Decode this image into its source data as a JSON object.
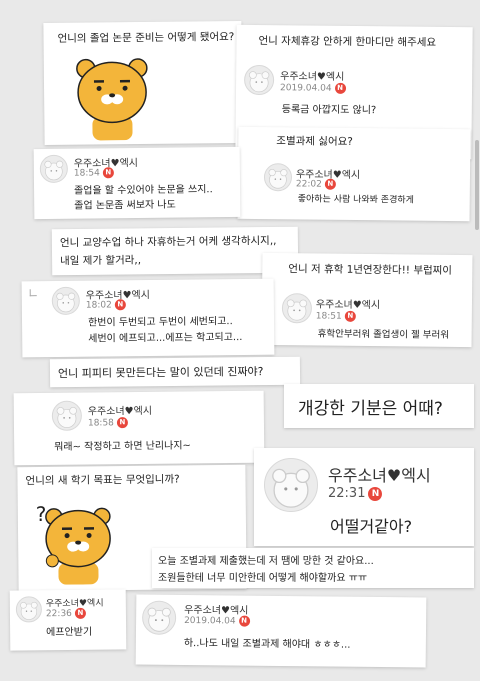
{
  "items": [
    {
      "question": "언니의 졸업 논문 준비는 어떻게 됐어요?"
    },
    {
      "question": "언니 자체휴강 안하게 한마디만 해주세요",
      "user": "우주소녀♥엑시",
      "time": "2019.04.04",
      "badge": "N",
      "lines": [
        "등록금 아깝지도 않니?"
      ]
    },
    {
      "question": "조별과제 싫어요?",
      "user": "우주소녀♥엑시",
      "time": "22:02",
      "badge": "N",
      "lines": [
        "좋아하는 사람 나와봐 존경하게"
      ]
    },
    {
      "user": "우주소녀♥엑시",
      "time": "18:54",
      "badge": "N",
      "lines": [
        "졸업을 할 수있어야 논문을 쓰지..",
        "졸업 논문좀 써보자 나도"
      ]
    },
    {
      "question": "언니 교양수업 하나 자휴하는거 어케 생각하시지,,",
      "question2": "내일 제가 할거라,,"
    },
    {
      "question": "언니 저 휴학 1년연장한다!! 부럽찌이",
      "user": "우주소녀♥엑시",
      "time": "18:51",
      "badge": "N",
      "lines": [
        "휴학안부러워 졸업생이 젤 부러워"
      ]
    },
    {
      "user": "우주소녀♥엑시",
      "time": "18:02",
      "badge": "N",
      "lines": [
        "한번이 두번되고 두번이 세번되고..",
        "세번이 에프되고...에프는 학고되고..."
      ]
    },
    {
      "question": "언니 피피티 못만든다는 말이 있던데 진짜야?"
    },
    {
      "question": "개강한 기분은 어때?"
    },
    {
      "user": "우주소녀♥엑시",
      "time": "18:58",
      "badge": "N",
      "lines": [
        "뭐래~ 작정하고 하면 난리나지~"
      ]
    },
    {
      "question": "언니의 새 학기 목표는 무엇입니까?"
    },
    {
      "user": "우주소녀♥엑시",
      "time": "22:31",
      "badge": "N",
      "lines": [
        "어떨거같아?"
      ]
    },
    {
      "question": "오늘 조별과제 제출했는데 저 땜에 망한 것 같아요...",
      "question2": "조원들한테 너무 미안한데 어떻게 해야할까요 ㅠㅠ"
    },
    {
      "user": "우주소녀♥엑시",
      "time": "22:36",
      "badge": "N",
      "lines": [
        "에프안받기"
      ]
    },
    {
      "user": "우주소녀♥엑시",
      "time": "2019.04.04",
      "badge": "N",
      "lines": [
        "하..나도 내일 조별과제 해야대 ㅎㅎㅎ..."
      ]
    }
  ]
}
